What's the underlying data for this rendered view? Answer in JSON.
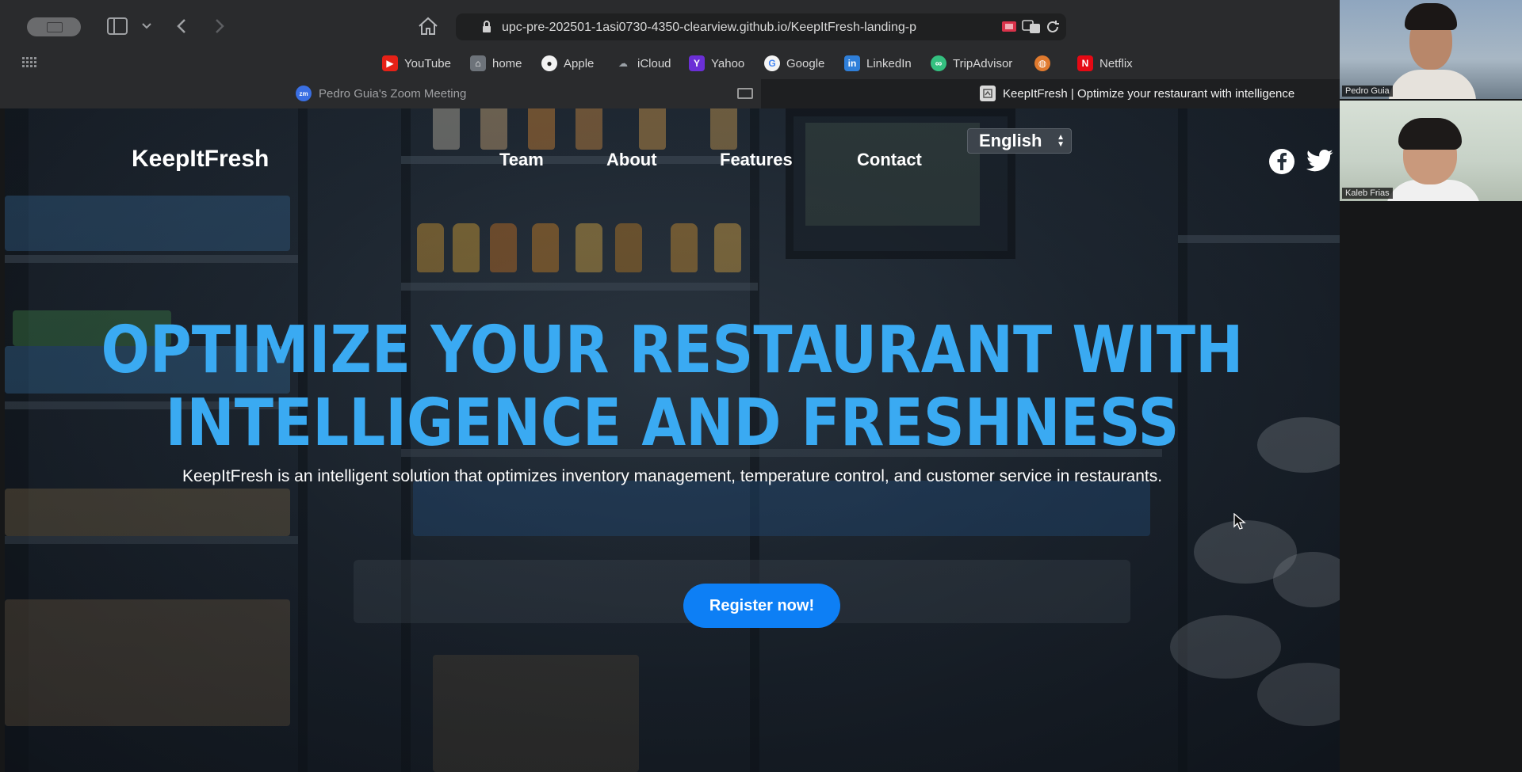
{
  "browser": {
    "url": "upc-pre-202501-1asi0730-4350-clearview.github.io/KeepItFresh-landing-p",
    "bookmarks": [
      {
        "label": "YouTube",
        "icon": "youtube-icon",
        "color": "#e62117"
      },
      {
        "label": "home",
        "icon": "home-bookmark-icon",
        "color": "#8a8f96"
      },
      {
        "label": "Apple",
        "icon": "apple-icon",
        "color": "#ffffff"
      },
      {
        "label": "iCloud",
        "icon": "icloud-icon",
        "color": "#9aa0a6"
      },
      {
        "label": "Yahoo",
        "icon": "yahoo-icon",
        "color": "#6b2fd6"
      },
      {
        "label": "Google",
        "icon": "google-icon",
        "color": "#ffffff"
      },
      {
        "label": "LinkedIn",
        "icon": "linkedin-icon",
        "color": "#2f7fd9"
      },
      {
        "label": "TripAdvisor",
        "icon": "tripadvisor-icon",
        "color": "#34c080"
      },
      {
        "label": "",
        "icon": "globe-icon",
        "color": "#e07a2e"
      },
      {
        "label": "Netflix",
        "icon": "netflix-icon",
        "color": "#e50914"
      }
    ],
    "tabs": [
      {
        "label": "Pedro Guia's Zoom Meeting",
        "icon": "zoom-icon",
        "icon_text": "zm"
      },
      {
        "label": "KeepItFresh | Optimize your restaurant with intelligence",
        "icon": "site-favicon"
      }
    ]
  },
  "site": {
    "brand": "KeepItFresh",
    "nav": [
      "Team",
      "About",
      "Features",
      "Contact"
    ],
    "language": "English",
    "hero_title": "OPTIMIZE YOUR RESTAURANT WITH INTELLIGENCE AND FRESHNESS",
    "hero_subtitle": "KeepItFresh is an intelligent solution that optimizes inventory management, temperature control, and customer service in restaurants.",
    "cta": "Register now!",
    "accent": "#3aaaf2",
    "button_color": "#0d7ff5"
  },
  "participants": [
    {
      "name": "Pedro Guia"
    },
    {
      "name": "Kaleb Frias"
    }
  ]
}
